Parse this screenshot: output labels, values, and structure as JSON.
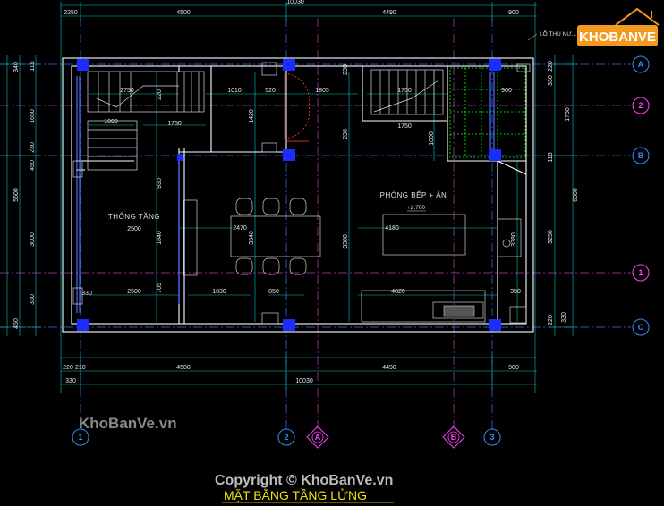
{
  "title": "MẶT BẰNG TẦNG LỬNG",
  "copyright": "Copyright © KhoBanVe.vn",
  "watermark": "KhoBanVe.vn",
  "logo": {
    "text": "KHOBANVE",
    "icon": "house-logo-icon",
    "color": "#f39a1e"
  },
  "rooms": {
    "void": "THÔNG TẦNG",
    "living": "PHÒNG BẾP + ĂN",
    "level": "+2.700",
    "skylight_note": "LỖ THU NƯ..."
  },
  "top_dims": {
    "total": "10030",
    "a": "2250",
    "b": "4500",
    "c": "4490",
    "d": "900"
  },
  "bottom_dims": {
    "a": "220",
    "a2": "210",
    "b": "4500",
    "c": "4490",
    "d": "900",
    "e": "330",
    "total": "10030"
  },
  "left_dims": [
    "340",
    "115",
    "1650",
    "230",
    "450",
    "5600",
    "3000",
    "330",
    "450"
  ],
  "right_dims": [
    "220",
    "330",
    "1750",
    "115",
    "6000",
    "3250",
    "220",
    "330"
  ],
  "interior_dims": {
    "d1": "2750",
    "d2": "1010",
    "d3": "520",
    "d4": "1805",
    "d5": "1750",
    "d6": "900",
    "d7": "1750",
    "d8": "1000",
    "d9": "2500",
    "d10": "1840",
    "d11": "2470",
    "d12": "3340",
    "d13": "4180",
    "d14": "3380",
    "d15": "2500",
    "d16": "1830",
    "d17": "850",
    "d18": "4820",
    "d19": "350",
    "d20": "1420",
    "d21": "1000",
    "d22": "930",
    "d23": "900",
    "d24": "705",
    "d25": "110",
    "d26": "230",
    "d27": "220"
  },
  "axes": {
    "bottom": [
      {
        "label": "1",
        "color": "#2f8fff"
      },
      {
        "label": "2",
        "color": "#2f8fff"
      },
      {
        "label": "A",
        "color": "#ff40ff"
      },
      {
        "label": "B",
        "color": "#ff40ff"
      },
      {
        "label": "3",
        "color": "#2f8fff"
      }
    ],
    "right": [
      {
        "label": "A",
        "color": "#2f8fff"
      },
      {
        "label": "2",
        "color": "#ff40ff"
      },
      {
        "label": "B",
        "color": "#2f8fff"
      },
      {
        "label": "1",
        "color": "#ff40ff"
      },
      {
        "label": "C",
        "color": "#2f8fff"
      }
    ]
  },
  "colors": {
    "wall": "#ffffff",
    "column": "#1a2cff",
    "grid": "#b040b0",
    "dim": "#00c8c8",
    "furniture": "#cfcfcf",
    "skylight": "#00ff00",
    "window": "#4d6bff",
    "door": "#ff4040",
    "title": "#f5e400"
  }
}
